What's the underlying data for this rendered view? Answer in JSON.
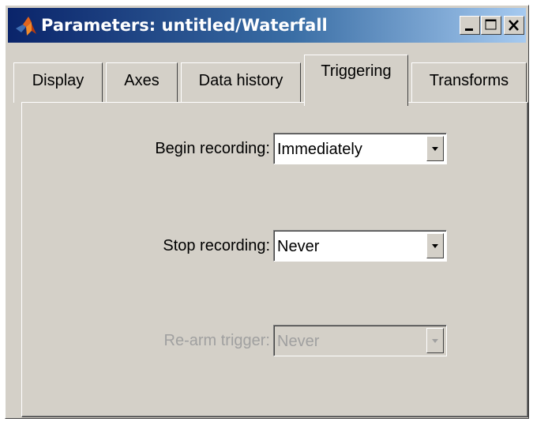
{
  "window": {
    "title": "Parameters: untitled/Waterfall",
    "icon": "matlab-icon",
    "controls": {
      "minimize_icon": "minimize-icon",
      "maximize_icon": "maximize-icon",
      "close_icon": "close-icon"
    }
  },
  "tabs": [
    {
      "label": "Display",
      "active": false
    },
    {
      "label": "Axes",
      "active": false
    },
    {
      "label": "Data history",
      "active": false
    },
    {
      "label": "Triggering",
      "active": true
    },
    {
      "label": "Transforms",
      "active": false
    }
  ],
  "triggering": {
    "begin_recording": {
      "label": "Begin recording:",
      "value": "Immediately",
      "enabled": true
    },
    "stop_recording": {
      "label": "Stop recording:",
      "value": "Never",
      "enabled": true
    },
    "rearm_trigger": {
      "label": "Re-arm trigger:",
      "value": "Never",
      "enabled": false
    }
  },
  "colors": {
    "titlebar_start": "#0a246a",
    "titlebar_end": "#a6caf0",
    "face": "#d4d0c8",
    "disabled_text": "#a0a0a0"
  }
}
